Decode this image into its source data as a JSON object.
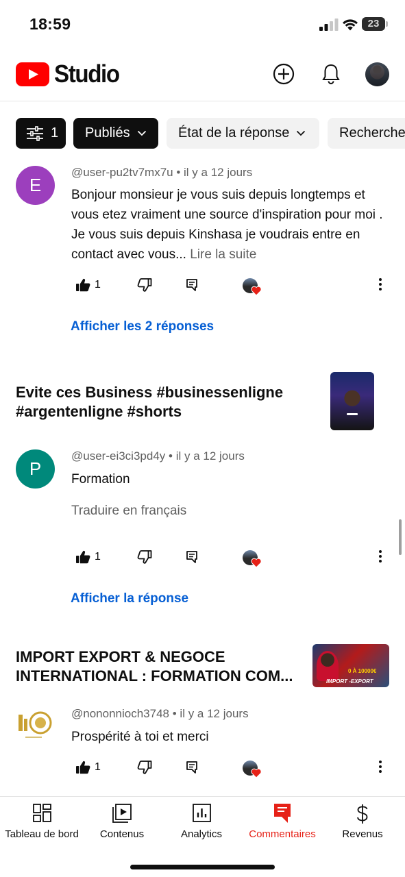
{
  "status_bar": {
    "time": "18:59",
    "battery": "23",
    "icons": [
      "cellular-signal-icon",
      "wifi-icon",
      "battery-icon"
    ]
  },
  "header": {
    "logo_text": "Studio",
    "icons": [
      "youtube-play-icon",
      "create-plus-icon",
      "notifications-bell-icon"
    ],
    "brand_color": "#ff0000"
  },
  "filters": {
    "filter_count": "1",
    "published": "Publiés",
    "response_state": "État de la réponse",
    "search": "Recherche"
  },
  "comments": [
    {
      "avatar_letter": "E",
      "avatar_color": "#9c3fbd",
      "author": "@user-pu2tv7mx7u",
      "time": "il y a 12 jours",
      "text": "Bonjour monsieur je vous suis depuis longtemps et vous etez vraiment une source d'inspiration pour moi . Je vous suis depuis Kinshasa je voudrais entre en contact avec vous...",
      "read_more": "Lire la suite",
      "likes": "1",
      "replies_link": "Afficher les 2 réponses"
    },
    {
      "avatar_letter": "P",
      "avatar_color": "#00897b",
      "author": "@user-ei3ci3pd4y",
      "time": "il y a 12 jours",
      "text": "Formation",
      "translate": "Traduire en français",
      "likes": "1",
      "replies_link": "Afficher la réponse"
    },
    {
      "author": "@nononnioch3748",
      "time": "il y a 12 jours",
      "text": "Prospérité à toi et merci",
      "likes": "1"
    }
  ],
  "videos": [
    {
      "title": "Evite ces Business #businessenligne #argentenligne #shorts"
    },
    {
      "title": "IMPORT EXPORT & NEGOCE INTERNATIONAL : FORMATION COM...",
      "thumb_text": "IMPORT -EXPORT",
      "thumb_amount": "0 À 10000€"
    }
  ],
  "bottom_nav": [
    {
      "label": "Tableau de bord",
      "icon": "dashboard-icon"
    },
    {
      "label": "Contenus",
      "icon": "content-icon"
    },
    {
      "label": "Analytics",
      "icon": "analytics-icon"
    },
    {
      "label": "Commentaires",
      "icon": "comments-icon",
      "active": true
    },
    {
      "label": "Revenus",
      "icon": "dollar-icon"
    }
  ],
  "accent_colors": {
    "link": "#065fd4",
    "active_nav": "#e62117",
    "heart": "#e62117"
  }
}
